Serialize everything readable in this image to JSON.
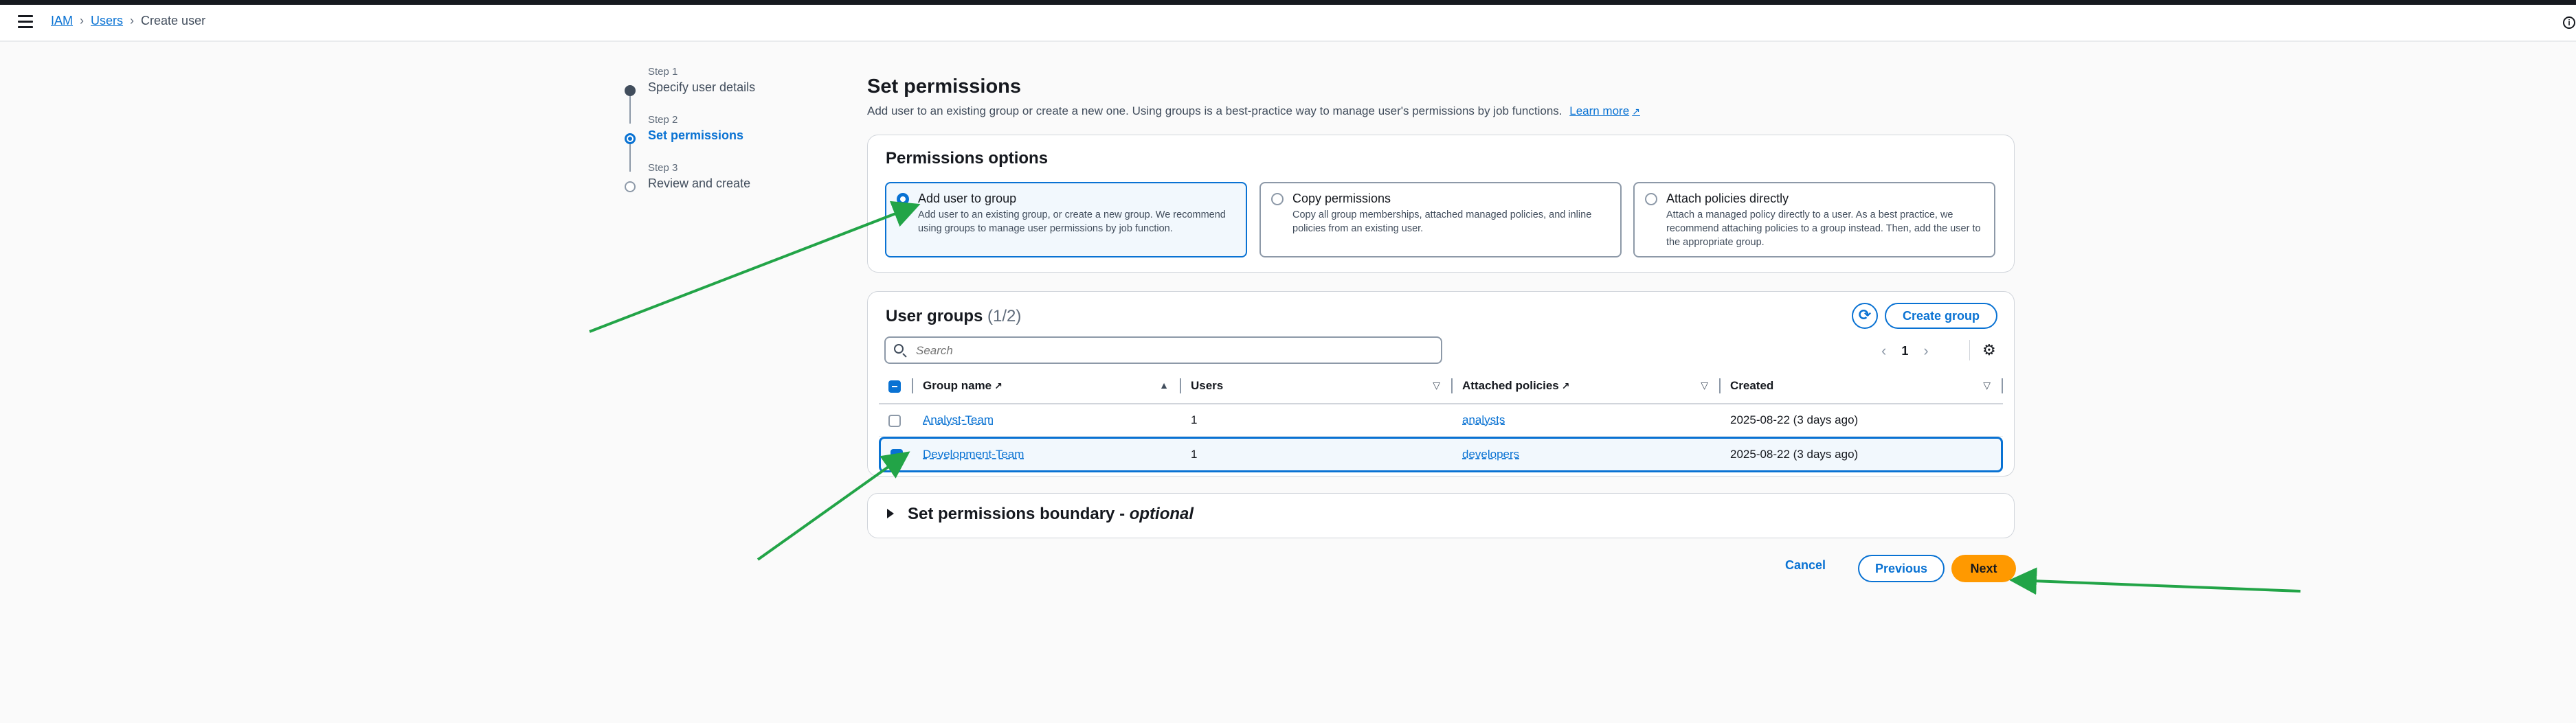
{
  "header": {
    "breadcrumb": {
      "iam": "IAM",
      "users": "Users",
      "current": "Create user"
    },
    "info_icon": "ⓘ"
  },
  "steps": [
    {
      "label": "Step 1",
      "title": "Specify user details",
      "state": "done"
    },
    {
      "label": "Step 2",
      "title": "Set permissions",
      "state": "active"
    },
    {
      "label": "Step 3",
      "title": "Review and create",
      "state": "pending"
    }
  ],
  "main": {
    "title": "Set permissions",
    "description": "Add user to an existing group or create a new one. Using groups is a best-practice way to manage user's permissions by job functions.",
    "learn_more": "Learn more"
  },
  "permissions_options": {
    "title": "Permissions options",
    "options": [
      {
        "title": "Add user to group",
        "desc": "Add user to an existing group, or create a new group. We recommend using groups to manage user permissions by job function.",
        "selected": true
      },
      {
        "title": "Copy permissions",
        "desc": "Copy all group memberships, attached managed policies, and inline policies from an existing user.",
        "selected": false
      },
      {
        "title": "Attach policies directly",
        "desc": "Attach a managed policy directly to a user. As a best practice, we recommend attaching policies to a group instead. Then, add the user to the appropriate group.",
        "selected": false
      }
    ]
  },
  "user_groups": {
    "title": "User groups",
    "count": "(1/2)",
    "create_group": "Create group",
    "search_placeholder": "Search",
    "page": "1",
    "columns": [
      "Group name",
      "Users",
      "Attached policies",
      "Created"
    ],
    "rows": [
      {
        "name": "Analyst-Team",
        "users": "1",
        "policies": "analysts",
        "created": "2025-08-22 (3 days ago)",
        "selected": false
      },
      {
        "name": "Development-Team",
        "users": "1",
        "policies": "developers",
        "created": "2025-08-22 (3 days ago)",
        "selected": true
      }
    ]
  },
  "boundary": {
    "title": "Set permissions boundary - ",
    "optional": "optional"
  },
  "footer": {
    "cancel": "Cancel",
    "previous": "Previous",
    "next": "Next"
  },
  "colors": {
    "accent": "#0972d3",
    "primary_button": "#ff9900",
    "annotation_arrow": "#22a447"
  }
}
